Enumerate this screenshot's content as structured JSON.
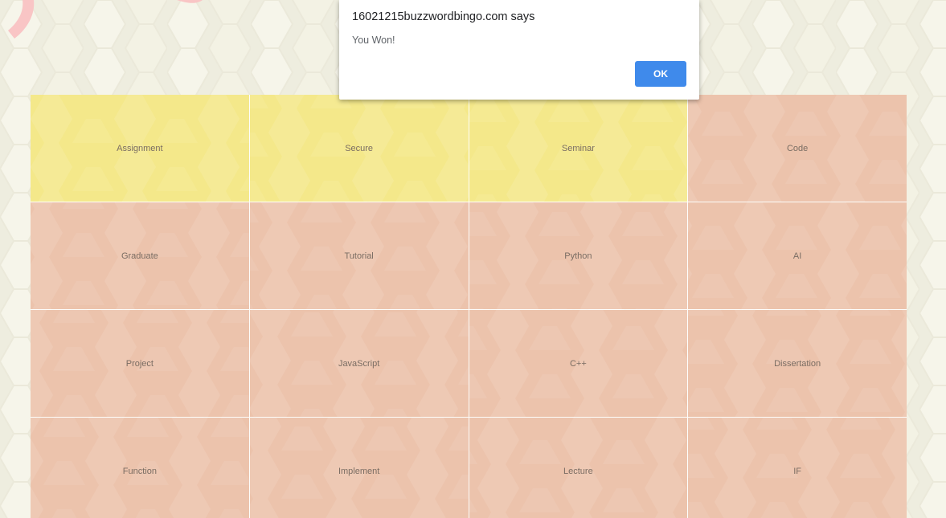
{
  "dialog": {
    "title": "16021215buzzwordbingo.com says",
    "message": "You Won!",
    "ok_label": "OK"
  },
  "board": {
    "cells": [
      {
        "label": "Assignment",
        "marked": true
      },
      {
        "label": "Secure",
        "marked": true
      },
      {
        "label": "Seminar",
        "marked": true
      },
      {
        "label": "Code",
        "marked": false
      },
      {
        "label": "Graduate",
        "marked": false
      },
      {
        "label": "Tutorial",
        "marked": false
      },
      {
        "label": "Python",
        "marked": false
      },
      {
        "label": "AI",
        "marked": false
      },
      {
        "label": "Project",
        "marked": false
      },
      {
        "label": "JavaScript",
        "marked": false
      },
      {
        "label": "C++",
        "marked": false
      },
      {
        "label": "Dissertation",
        "marked": false
      },
      {
        "label": "Function",
        "marked": false
      },
      {
        "label": "Implement",
        "marked": false
      },
      {
        "label": "Lecture",
        "marked": false
      },
      {
        "label": "IF",
        "marked": false
      }
    ]
  },
  "colors": {
    "marked": "#f4e88a",
    "unmarked": "#ecc3ac",
    "page_background": "#eeeddf",
    "button": "#3f8aeb"
  }
}
